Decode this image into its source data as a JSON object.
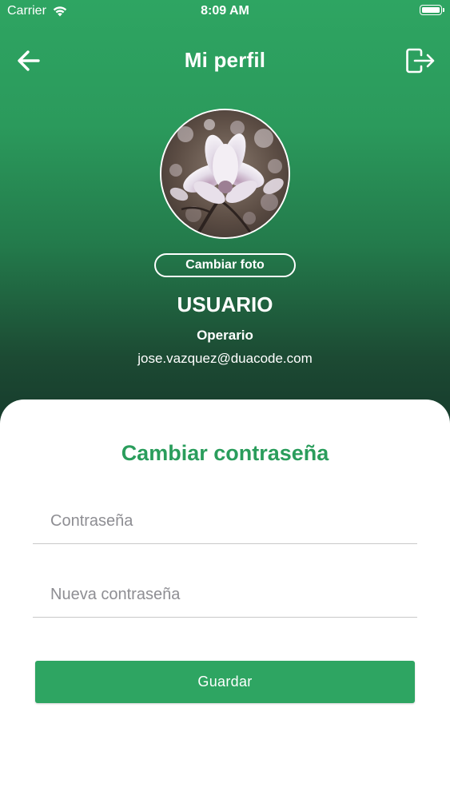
{
  "status_bar": {
    "carrier": "Carrier",
    "time": "8:09 AM"
  },
  "nav": {
    "title": "Mi perfil",
    "back_icon": "arrow-left-icon",
    "logout_icon": "logout-icon"
  },
  "profile": {
    "change_photo_label": "Cambiar foto",
    "name": "USUARIO",
    "role": "Operario",
    "email": "jose.vazquez@duacode.com"
  },
  "password_form": {
    "title": "Cambiar contraseña",
    "current_password": {
      "value": "",
      "placeholder": "Contraseña"
    },
    "new_password": {
      "value": "",
      "placeholder": "Nueva contraseña"
    },
    "save_label": "Guardar"
  },
  "colors": {
    "accent": "#2ea562",
    "header_top": "#2ea562",
    "header_bottom": "#15362a",
    "title_green": "#2a9d5c"
  }
}
